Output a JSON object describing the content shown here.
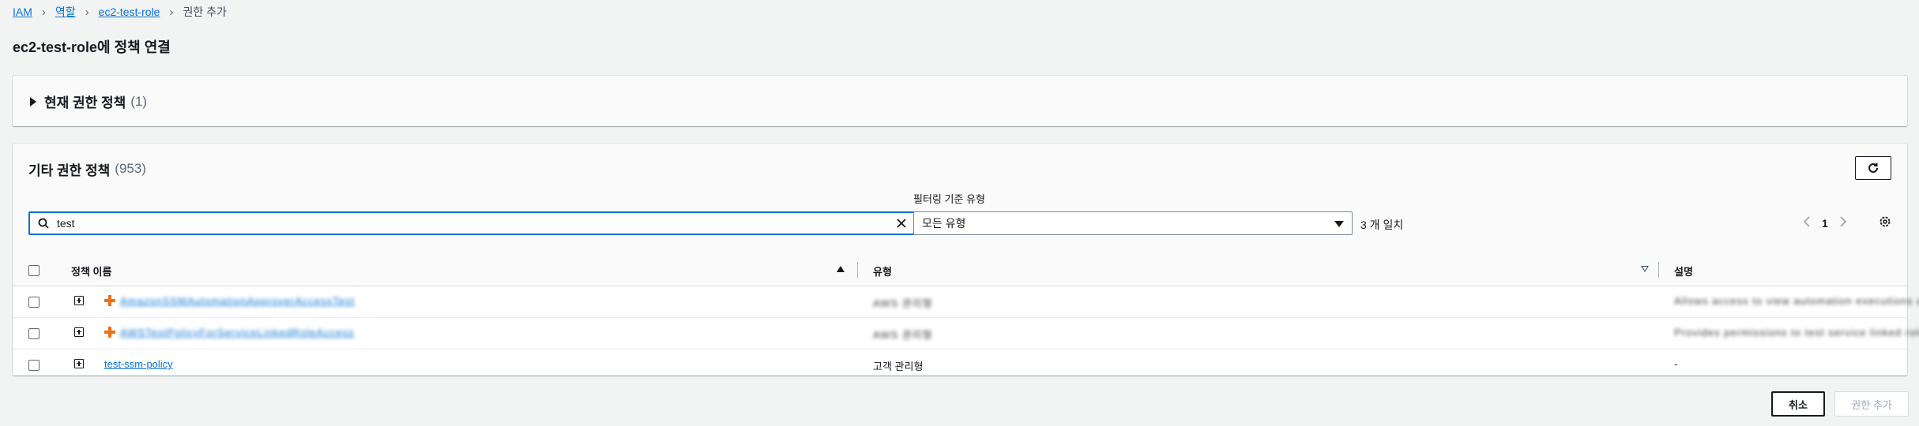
{
  "breadcrumb": {
    "items": [
      "IAM",
      "역할",
      "ec2-test-role"
    ],
    "current": "권한 추가"
  },
  "page_title": "ec2-test-role에 정책 연결",
  "current_policies": {
    "label": "현재 권한 정책",
    "count": "(1)"
  },
  "other_policies": {
    "label": "기타 권한 정책",
    "count": "(953)",
    "search": {
      "value": "test",
      "placeholder": ""
    },
    "filter": {
      "label": "필터링 기준 유형",
      "selected": "모든 유형"
    },
    "match_count": "3 개 일치",
    "page": "1",
    "columns": {
      "name": "정책 이름",
      "type": "유형",
      "description": "설명"
    },
    "rows": [
      {
        "name": "AmazonSSMAutomationApproverAccessTest",
        "type": "AWS 관리형",
        "description": "Allows access to view automation executions and approve",
        "aws_managed": true
      },
      {
        "name": "AWSTestPolicyForServiceLinkedRoleAccess",
        "type": "AWS 관리형",
        "description": "Provides permissions to test service linked role access",
        "aws_managed": true
      },
      {
        "name": "test-ssm-policy",
        "type": "고객 관리형",
        "description": "-",
        "aws_managed": false
      }
    ]
  },
  "actions": {
    "cancel": "취소",
    "add": "권한 추가"
  },
  "colors": {
    "link": "#0972d3",
    "aws_icon": "#ec7211",
    "border_focus": "#0972d3"
  },
  "icons": [
    "caret-right-icon",
    "refresh-icon",
    "search-icon",
    "clear-icon",
    "caret-down-icon",
    "chevron-left-icon",
    "chevron-right-icon",
    "settings-icon",
    "sort-ascending-icon",
    "sort-descending-icon",
    "expand-icon",
    "aws-managed-icon"
  ]
}
